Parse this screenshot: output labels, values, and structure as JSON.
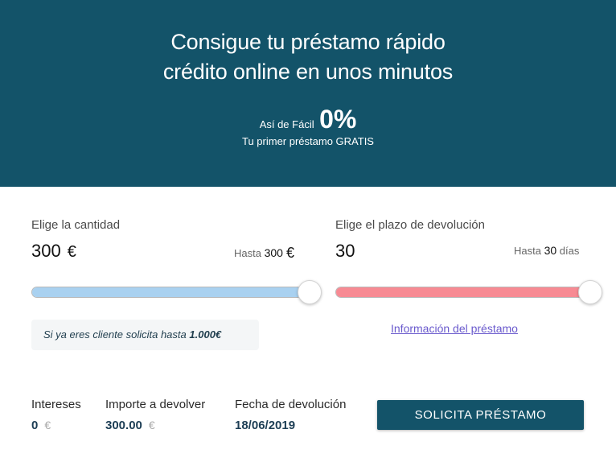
{
  "hero": {
    "title_line1": "Consigue tu préstamo rápido",
    "title_line2": "crédito online en unos minutos",
    "promo_prefix": "Así de Fácil",
    "promo_value": "0%",
    "promo_sub": "Tu primer préstamo GRATIS",
    "background": "#135369"
  },
  "amount": {
    "label": "Elige la cantidad",
    "value": "300",
    "currency": "€",
    "limit_prefix": "Hasta",
    "limit_value": "300",
    "limit_currency": "€",
    "slider_fraction": 1.0,
    "slider_color": "#a9d1f0"
  },
  "term": {
    "label": "Elige el plazo de devolución",
    "value": "30",
    "limit_prefix": "Hasta",
    "limit_value": "30",
    "limit_unit": "días",
    "slider_fraction": 1.0,
    "slider_color": "#f78a93"
  },
  "hint": {
    "text": "Si ya eres cliente solicita hasta",
    "amount": "1.000€"
  },
  "loan_info_link": "Información del préstamo",
  "summary": {
    "interest_label": "Intereses",
    "interest_value": "0",
    "interest_currency": "€",
    "repay_label": "Importe a devolver",
    "repay_value": "300.00",
    "repay_currency": "€",
    "date_label": "Fecha de devolución",
    "date_value": "18/06/2019"
  },
  "cta_label": "SOLICITA PRÉSTAMO"
}
